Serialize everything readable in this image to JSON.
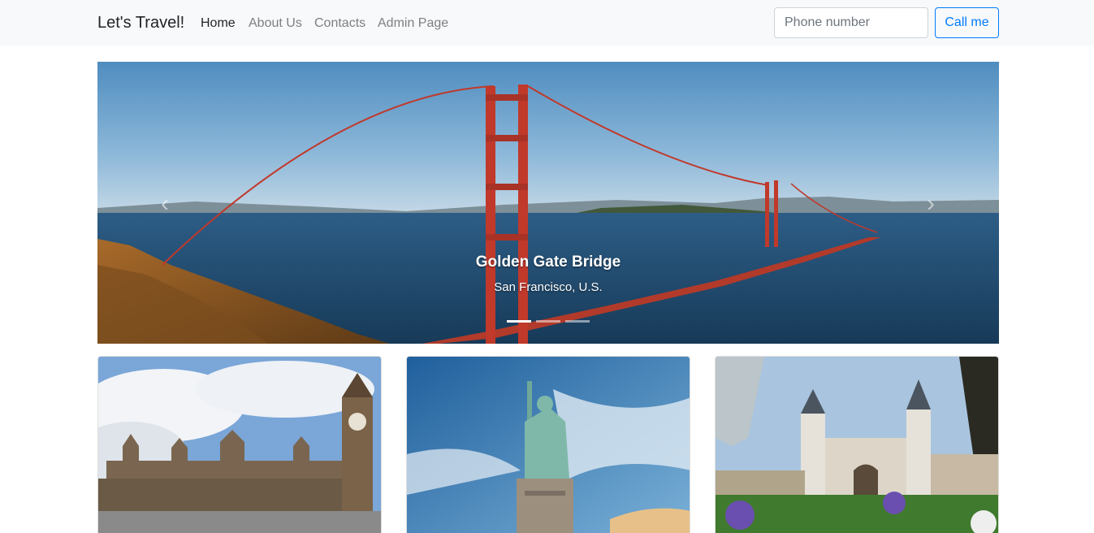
{
  "navbar": {
    "brand": "Let's Travel!",
    "links": [
      {
        "label": "Home",
        "active": true
      },
      {
        "label": "About Us",
        "active": false
      },
      {
        "label": "Contacts",
        "active": false
      },
      {
        "label": "Admin Page",
        "active": false
      }
    ],
    "phone_placeholder": "Phone number",
    "call_label": "Call me"
  },
  "carousel": {
    "slide": {
      "title": "Golden Gate Bridge",
      "subtitle": "San Francisco, U.S."
    },
    "slide_count": 3,
    "active_index": 0,
    "prev_icon": "chevron-left-icon",
    "next_icon": "chevron-right-icon"
  },
  "cards": [
    {
      "image": "london-big-ben-photo"
    },
    {
      "image": "statue-of-liberty-photo"
    },
    {
      "image": "topkapi-palace-photo"
    }
  ],
  "colors": {
    "accent": "#007bff",
    "navbar_bg": "#f8f9fa",
    "bridge": "#c0392b"
  }
}
